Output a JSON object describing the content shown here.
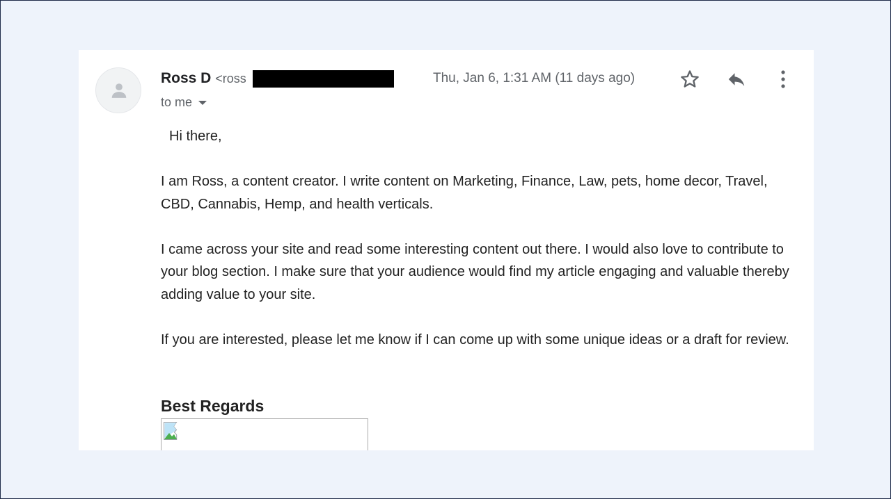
{
  "email": {
    "sender_name": "Ross D",
    "sender_email_partial": "<ross",
    "date": "Thu, Jan 6, 1:31 AM (11 days ago)",
    "recipient_label": "to me",
    "icons": {
      "avatar": "person-icon",
      "star": "star-icon",
      "reply": "reply-icon",
      "more": "more-vertical-icon",
      "recipient_toggle": "caret-down-icon",
      "image": "broken-image-icon"
    },
    "body": {
      "greeting": "Hi there,",
      "paragraphs": [
        "I am Ross, a content creator. I write content on Marketing, Finance, Law, pets, home decor, Travel, CBD, Cannabis, Hemp, and health verticals.",
        "I came across your site and read some interesting content out there. I would also love to contribute to your blog section. I make sure that your audience would find my article engaging and valuable thereby adding value to your site.",
        "If you are interested, please let me know if I can come up with some unique ideas or a draft for review."
      ],
      "signoff": "Best Regards"
    }
  },
  "colors": {
    "page_background": "#eef3fb",
    "card_background": "#ffffff",
    "frame_border": "#1e2a48",
    "text_primary": "#202124",
    "text_secondary": "#5f6368"
  }
}
